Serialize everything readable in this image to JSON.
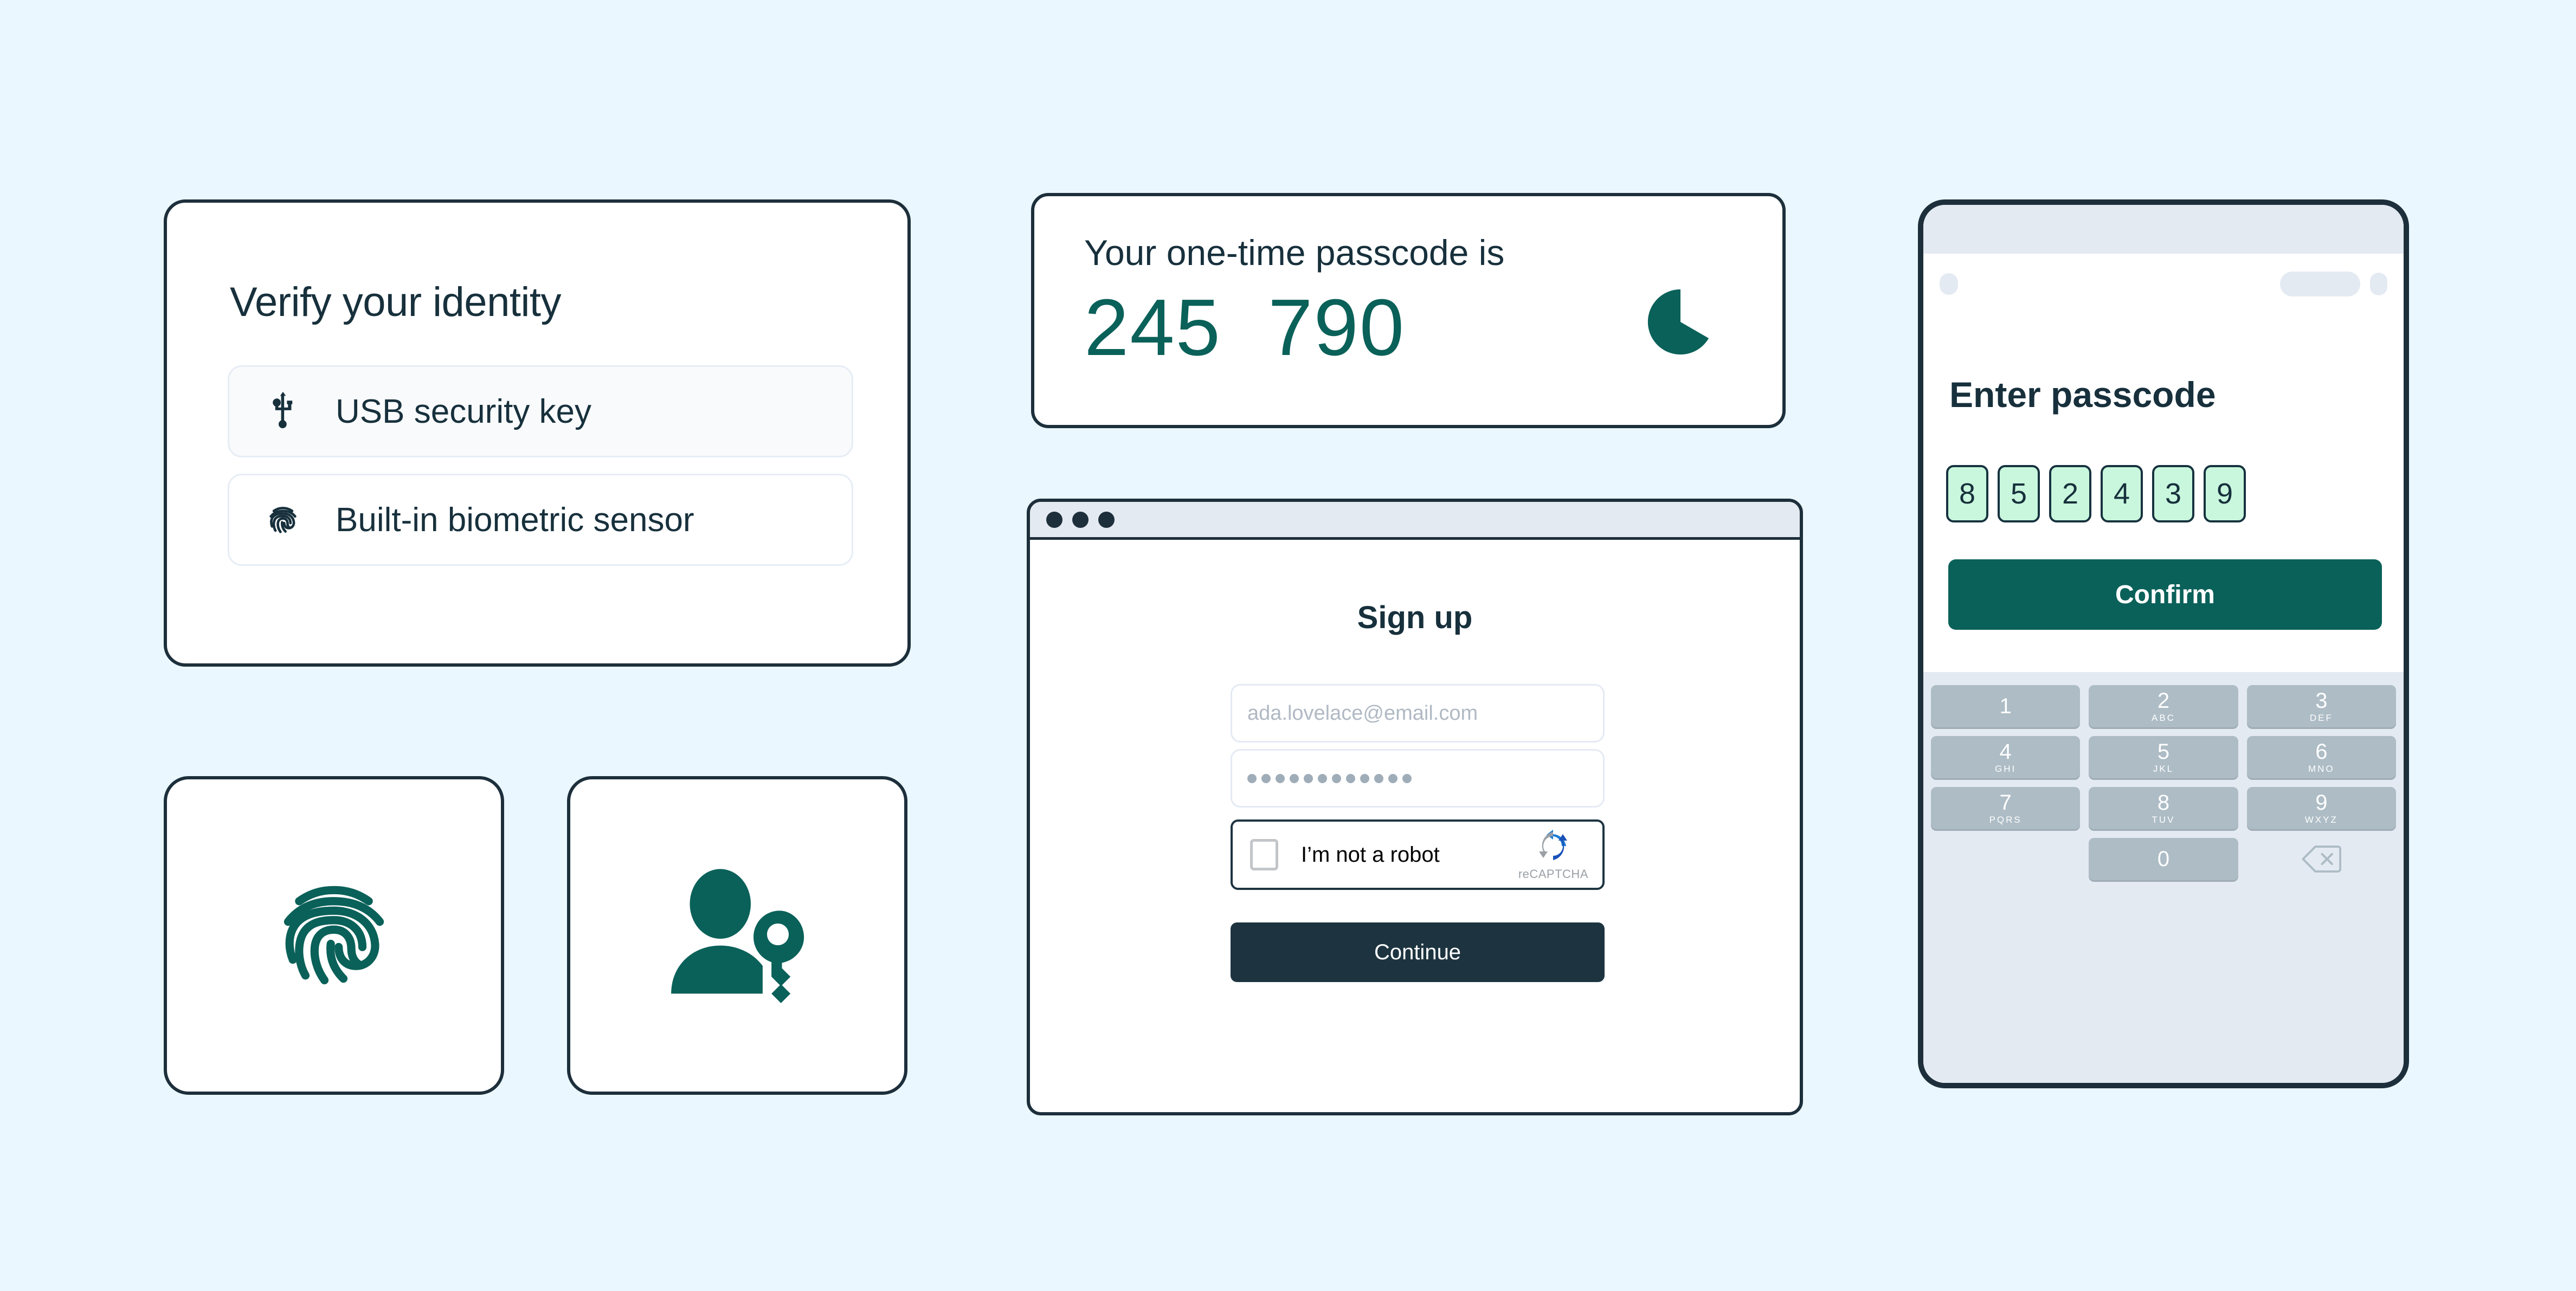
{
  "theme": {
    "background": "#eaf7fe",
    "ink": "#17303c",
    "teal": "#0a6159",
    "mint": "#c9f7dd",
    "dark_button": "#1d3440",
    "key_gray": "#adbcc5"
  },
  "verify_card": {
    "title": "Verify your identity",
    "options": [
      {
        "label": "USB security key",
        "icon": "usb-icon",
        "selected": true
      },
      {
        "label": "Built-in biometric sensor",
        "icon": "fingerprint-icon",
        "selected": false
      }
    ]
  },
  "icon_tiles": [
    {
      "icon": "fingerprint-icon",
      "name": "fingerprint-tile"
    },
    {
      "icon": "person-with-key-icon",
      "name": "person-key-tile"
    }
  ],
  "otp_card": {
    "label": "Your one-time passcode is",
    "code": "245  790",
    "code_digits": "245790",
    "timer_icon": "pie-timer-icon",
    "timer_remaining_percent": 83
  },
  "browser": {
    "window_dots": [
      "dot",
      "dot",
      "dot"
    ],
    "page_title": "Sign up",
    "email_field": {
      "value": "",
      "placeholder": "ada.lovelace@email.com"
    },
    "password_field": {
      "value": "",
      "masked_length": 12
    },
    "captcha": {
      "label": "I’m not a robot",
      "brand": "reCAPTCHA",
      "checked": false
    },
    "continue_label": "Continue"
  },
  "phone": {
    "heading": "Enter passcode",
    "entered_passcode": [
      "8",
      "5",
      "2",
      "4",
      "3",
      "9"
    ],
    "confirm_label": "Confirm",
    "keypad": [
      [
        {
          "digit": "1",
          "letters": ""
        },
        {
          "digit": "2",
          "letters": "ABC"
        },
        {
          "digit": "3",
          "letters": "DEF"
        }
      ],
      [
        {
          "digit": "4",
          "letters": "GHI"
        },
        {
          "digit": "5",
          "letters": "JKL"
        },
        {
          "digit": "6",
          "letters": "MNO"
        }
      ],
      [
        {
          "digit": "7",
          "letters": "PQRS"
        },
        {
          "digit": "8",
          "letters": "TUV"
        },
        {
          "digit": "9",
          "letters": "WXYZ"
        }
      ],
      [
        {
          "digit": "",
          "letters": ""
        },
        {
          "digit": "0",
          "letters": ""
        },
        {
          "digit": "backspace-icon",
          "letters": ""
        }
      ]
    ]
  }
}
